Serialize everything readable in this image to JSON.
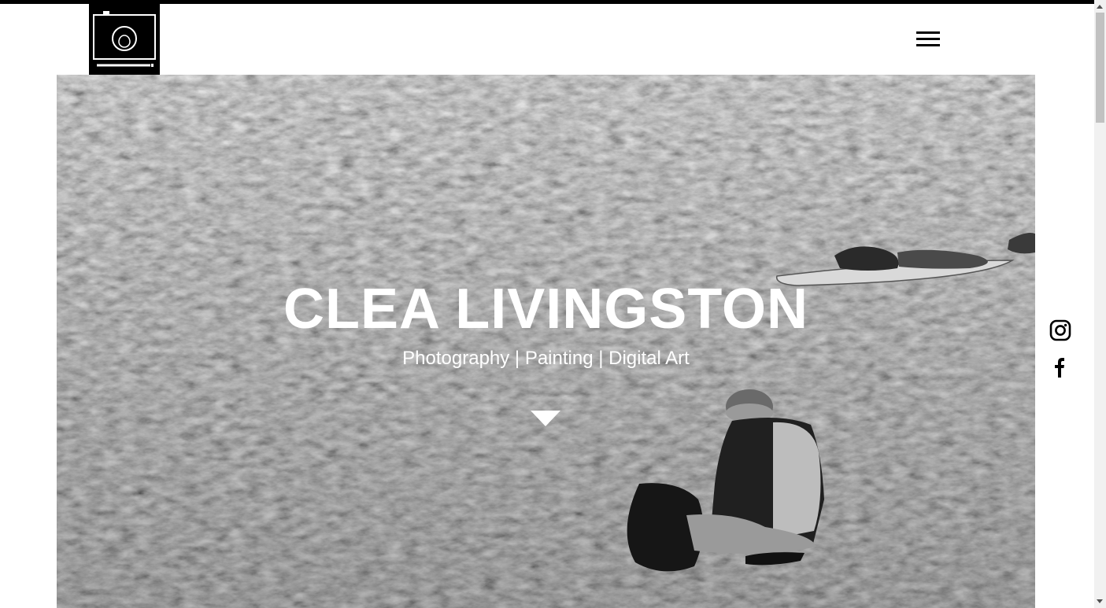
{
  "header": {
    "logo_icon": "camera-icon",
    "menu_icon": "hamburger-menu-icon"
  },
  "hero": {
    "title": "CLEA LIVINGSTON",
    "subtitle": "Photography | Painting | Digital Art",
    "scroll_icon": "triangle-down-icon"
  },
  "social": {
    "items": [
      {
        "icon": "instagram-icon"
      },
      {
        "icon": "facebook-icon"
      }
    ]
  },
  "colors": {
    "header_bar": "#000000",
    "text_light": "#ffffff",
    "icon_dark": "#000000"
  }
}
